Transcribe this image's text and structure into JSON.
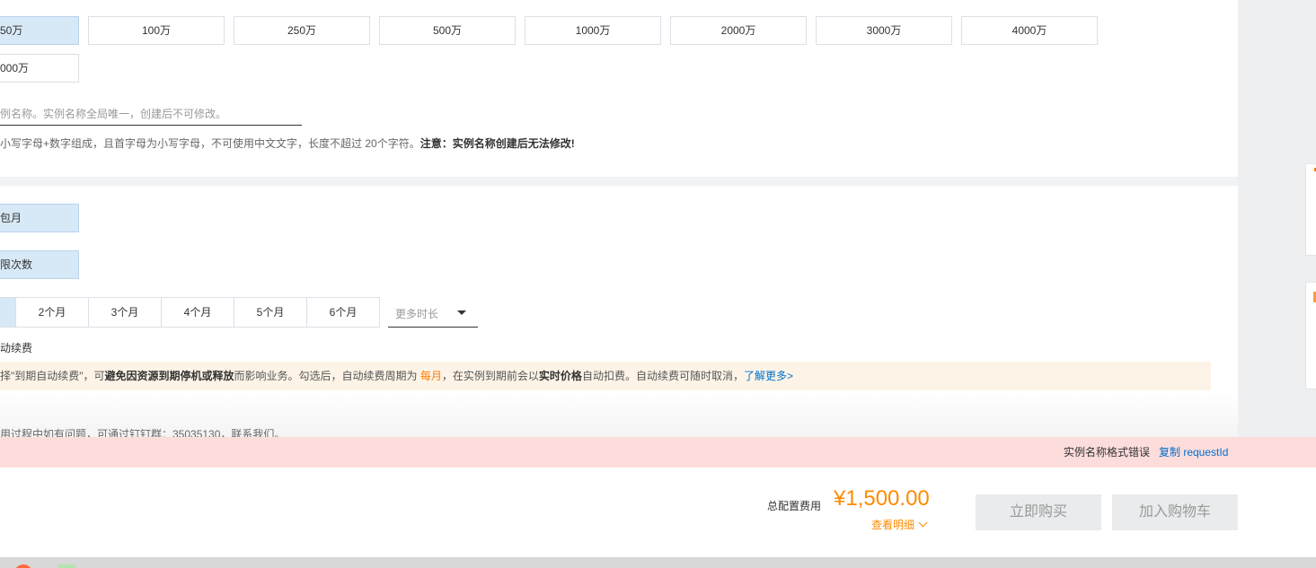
{
  "quota": {
    "options": [
      "50万",
      "100万",
      "250万",
      "500万",
      "1000万",
      "2000万",
      "3000万",
      "4000万"
    ],
    "second_row": "000万"
  },
  "name_field": {
    "placeholder": "例名称。实例名称全局唯一，创建后不可修改。",
    "rule": "小写字母+数字组成，且首字母为小写字母，不可使用中文文字，长度不超过 20个字符。",
    "rule_note": "注意：实例名称创建后无法修改!"
  },
  "billing": {
    "type_label": "包月",
    "limit_label": "限次数",
    "durations": [
      "2个月",
      "3个月",
      "4个月",
      "5个月",
      "6个月"
    ],
    "more_duration": "更多时长",
    "auto_renew_label": "动续费"
  },
  "notice": {
    "p1": "择\"到期自动续费\"，可",
    "b1": "避免因资源到期停机或释放",
    "p2": "而影响业务。勾选后，自动续费周期为 ",
    "orange": "每月",
    "p3": "，在实例到期前会以",
    "b2": "实时价格",
    "p4": "自动扣费。自动续费可随时取消，",
    "link": "了解更多>"
  },
  "contact": "用过程中如有问题，可通过钉钉群：35035130，联系我们。",
  "error": {
    "message": "实例名称格式错误",
    "copy_link": "复制 requestId"
  },
  "footer": {
    "total_label": "总配置费用",
    "price": "¥1,500.00",
    "detail_link": "查看明细",
    "buy_button": "立即购买",
    "cart_button": "加入购物车"
  },
  "colors": {
    "selected_bg": "#d7e8f6",
    "accent_orange": "#ff7a00",
    "link_blue": "#0070cc",
    "error_bg": "#fddcdc",
    "notice_bg": "#fdf4e7"
  }
}
